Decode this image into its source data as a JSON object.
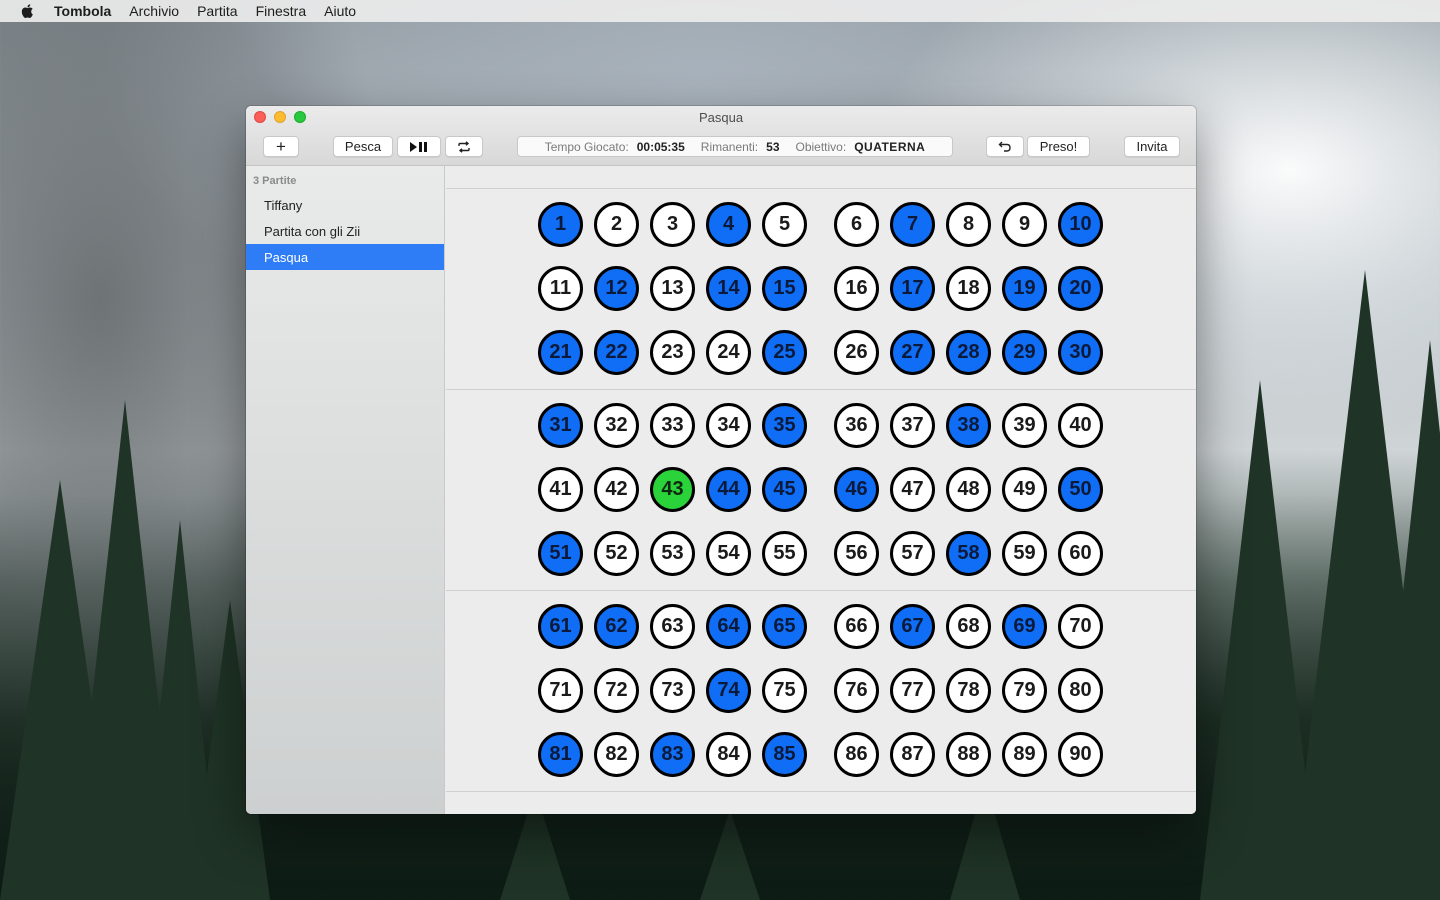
{
  "menubar": {
    "app": "Tombola",
    "items": [
      "Archivio",
      "Partita",
      "Finestra",
      "Aiuto"
    ]
  },
  "window": {
    "title": "Pasqua",
    "toolbar": {
      "add_label": "+",
      "draw_label": "Pesca",
      "play_pause_icon": "play-pause-icon",
      "repeat_icon": "repeat-icon",
      "status": {
        "time_label": "Tempo Giocato:",
        "time_value": "00:05:35",
        "remaining_label": "Rimanenti:",
        "remaining_value": "53",
        "goal_label": "Obiettivo:",
        "goal_value": "QUATERNA"
      },
      "undo_icon": "undo-icon",
      "claim_label": "Preso!",
      "invite_label": "Invita"
    }
  },
  "sidebar": {
    "header": "3 Partite",
    "items": [
      {
        "label": "Tiffany",
        "selected": false
      },
      {
        "label": "Partita con gli Zii",
        "selected": false
      },
      {
        "label": "Pasqua",
        "selected": true
      }
    ]
  },
  "board": {
    "numbers_total": 90,
    "called": [
      1,
      4,
      7,
      10,
      12,
      14,
      15,
      17,
      19,
      20,
      21,
      22,
      25,
      27,
      28,
      29,
      30,
      31,
      35,
      38,
      44,
      45,
      46,
      50,
      51,
      58,
      61,
      62,
      64,
      65,
      67,
      69,
      74,
      81,
      83,
      85
    ],
    "current": 43,
    "colors": {
      "called": "#0f6ef5",
      "current": "#2ad33a",
      "uncalled": "#ffffff",
      "outline": "#000000"
    }
  }
}
